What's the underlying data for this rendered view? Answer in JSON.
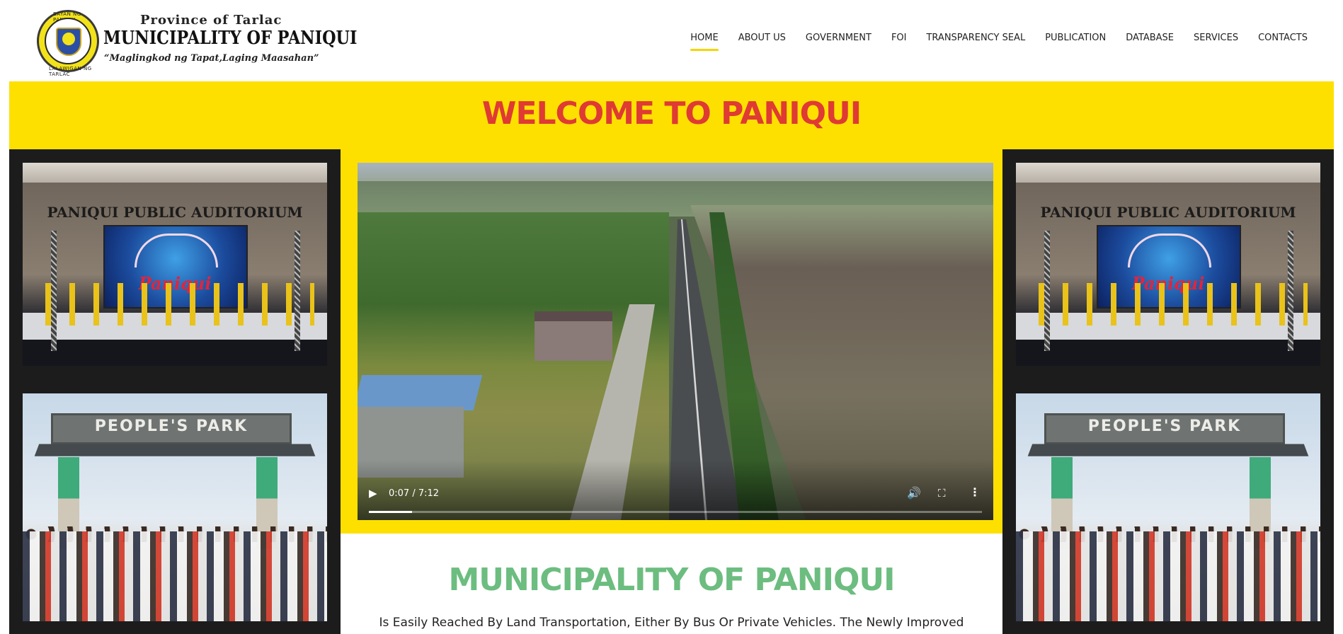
{
  "header": {
    "seal_text_top": "BAYAN NG PANIQUI",
    "seal_text_bottom": "LALAWIGAN NG TARLAC",
    "province": "Province of Tarlac",
    "title": "MUNICIPALITY OF PANIQUI",
    "motto": "“Maglingkod ng Tapat,Laging Maasahan”"
  },
  "nav": {
    "items": [
      {
        "label": "HOME",
        "active": true
      },
      {
        "label": "ABOUT US",
        "active": false
      },
      {
        "label": "GOVERNMENT",
        "active": false
      },
      {
        "label": "FOI",
        "active": false
      },
      {
        "label": "TRANSPARENCY SEAL",
        "active": false
      },
      {
        "label": "PUBLICATION",
        "active": false
      },
      {
        "label": "DATABASE",
        "active": false
      },
      {
        "label": "SERVICES",
        "active": false
      },
      {
        "label": "CONTACTS",
        "active": false
      }
    ],
    "active_color": "#f4d600"
  },
  "banner": {
    "welcome": "WELCOME TO PANIQUI",
    "background": "#fde000",
    "text_color": "#df3a34"
  },
  "photos": {
    "auditorium_sign": "PANIQUI PUBLIC AUDITORIUM",
    "auditorium_screen_word": "Paniqui",
    "park_sign": "PEOPLE'S PARK"
  },
  "video": {
    "time": "0:07 / 7:12",
    "progress": 0.016,
    "play_icon": "▶",
    "volume_icon": "🔊",
    "fullscreen_icon": "⛶",
    "more_icon": "⋮"
  },
  "section": {
    "heading": "MUNICIPALITY OF PANIQUI",
    "heading_color": "#6cbd7f",
    "description": "Is Easily Reached By Land Transportation, Either By Bus Or Private Vehicles. The Newly Improved"
  }
}
